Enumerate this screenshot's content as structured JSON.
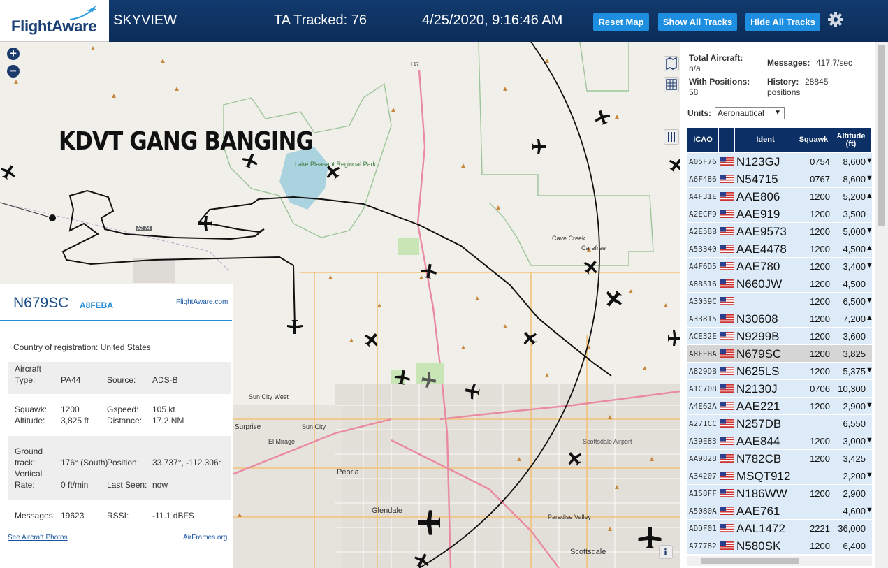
{
  "header": {
    "logo_text": "FlightAware",
    "site_name": "SKYVIEW",
    "tracked": "TA Tracked: 76",
    "clock": "4/25/2020, 9:16:46 AM",
    "reset_label": "Reset Map",
    "show_label": "Show All Tracks",
    "hide_label": "Hide All Tracks"
  },
  "map": {
    "graffiti": "KDVT GANG BANGING",
    "labels": {
      "lake_pleasant": "Lake Pleasant Regional Park",
      "cave_creek": "Cave Creek",
      "carefree": "Carefree",
      "sun_city_west": "Sun City West",
      "sun_city": "Sun City",
      "surprise": "Surprise",
      "el_mirage": "El Mirage",
      "peoria": "Peoria",
      "glendale": "Glendale",
      "paradise_valley": "Paradise Valley",
      "scottsdale": "Scottsdale",
      "scottsdale_airport": "Scottsdale Airport",
      "az74": "AZ 74",
      "i17": "I 17"
    }
  },
  "info": {
    "callsign": "N679SC",
    "icao": "A8FEBA",
    "fa_link": "FlightAware.com",
    "country_label": "Country of registration:",
    "country": "United States",
    "aircraft_type_label": "Aircraft Type:",
    "aircraft_type": "PA44",
    "source_label": "Source:",
    "source": "ADS-B",
    "squawk_label": "Squawk:",
    "squawk": "1200",
    "altitude_label": "Altitude:",
    "altitude": "3,825 ft",
    "gspeed_label": "Gspeed:",
    "gspeed": "105 kt",
    "distance_label": "Distance:",
    "distance": "17.2 NM",
    "track_label": "Ground track:",
    "track": "176° (South)",
    "position_label": "Position:",
    "position": "33.737°, -112.306°",
    "vrate_label": "Vertical Rate:",
    "vrate": "0 ft/min",
    "lastseen_label": "Last Seen:",
    "lastseen": "now",
    "messages_label": "Messages:",
    "messages": "19623",
    "rssi_label": "RSSI:",
    "rssi": "-11.1 dBFS",
    "photos_link": "See Aircraft Photos",
    "airframes_link": "AirFrames.org"
  },
  "stats": {
    "total_label": "Total Aircraft:",
    "total": "n/a",
    "positions_label": "With Positions:",
    "positions": "58",
    "messages_label": "Messages:",
    "messages": "417.7/sec",
    "history_label": "History:",
    "history": "28845 positions"
  },
  "units": {
    "label": "Units:",
    "selected": "Aeronautical"
  },
  "table": {
    "headers": [
      "ICAO",
      "Ident",
      "Squawk",
      "Altitude (ft)"
    ],
    "rows": [
      {
        "icao": "A05F76",
        "ident": "N123GJ",
        "squawk": "0754",
        "alt": "8,600",
        "trend": "▼"
      },
      {
        "icao": "A6F486",
        "ident": "N54715",
        "squawk": "0767",
        "alt": "8,600",
        "trend": "▼"
      },
      {
        "icao": "A4F31E",
        "ident": "AAE806",
        "squawk": "1200",
        "alt": "5,200",
        "trend": "▲"
      },
      {
        "icao": "A2ECF9",
        "ident": "AAE919",
        "squawk": "1200",
        "alt": "3,500",
        "trend": ""
      },
      {
        "icao": "A2E58B",
        "ident": "AAE9573",
        "squawk": "1200",
        "alt": "5,000",
        "trend": "▼"
      },
      {
        "icao": "A53340",
        "ident": "AAE4478",
        "squawk": "1200",
        "alt": "4,500",
        "trend": "▲"
      },
      {
        "icao": "A4F6D5",
        "ident": "AAE780",
        "squawk": "1200",
        "alt": "3,400",
        "trend": "▼"
      },
      {
        "icao": "A8B516",
        "ident": "N660JW",
        "squawk": "1200",
        "alt": "4,500",
        "trend": ""
      },
      {
        "icao": "A3059C",
        "ident": "",
        "squawk": "1200",
        "alt": "6,500",
        "trend": "▼"
      },
      {
        "icao": "A33815",
        "ident": "N30608",
        "squawk": "1200",
        "alt": "7,200",
        "trend": "▲"
      },
      {
        "icao": "ACE32E",
        "ident": "N9299B",
        "squawk": "1200",
        "alt": "3,600",
        "trend": ""
      },
      {
        "icao": "A8FEBA",
        "ident": "N679SC",
        "squawk": "1200",
        "alt": "3,825",
        "trend": ""
      },
      {
        "icao": "A829DB",
        "ident": "N625LS",
        "squawk": "1200",
        "alt": "5,375",
        "trend": "▼"
      },
      {
        "icao": "A1C708",
        "ident": "N2130J",
        "squawk": "0706",
        "alt": "10,300",
        "trend": ""
      },
      {
        "icao": "A4E62A",
        "ident": "AAE221",
        "squawk": "1200",
        "alt": "2,900",
        "trend": "▼"
      },
      {
        "icao": "A271CC",
        "ident": "N257DB",
        "squawk": "",
        "alt": "6,550",
        "trend": ""
      },
      {
        "icao": "A39E83",
        "ident": "AAE844",
        "squawk": "1200",
        "alt": "3,000",
        "trend": "▼"
      },
      {
        "icao": "AA9828",
        "ident": "N782CB",
        "squawk": "1200",
        "alt": "3,425",
        "trend": ""
      },
      {
        "icao": "A34207",
        "ident": "MSQT912",
        "squawk": "",
        "alt": "2,200",
        "trend": "▼"
      },
      {
        "icao": "A158FF",
        "ident": "N186WW",
        "squawk": "1200",
        "alt": "2,900",
        "trend": ""
      },
      {
        "icao": "A5080A",
        "ident": "AAE761",
        "squawk": "",
        "alt": "4,600",
        "trend": "▼"
      },
      {
        "icao": "ADDF01",
        "ident": "AAL1472",
        "squawk": "2221",
        "alt": "36,000",
        "trend": ""
      },
      {
        "icao": "A77782",
        "ident": "N580SK",
        "squawk": "1200",
        "alt": "6,400",
        "trend": ""
      }
    ]
  },
  "colors": {
    "header_bg": "#0c2d58",
    "button_bg": "#1e8fe0",
    "table_header": "#0c3066",
    "row_bg": "#dcebf7",
    "row_selected": "#d5d5d5",
    "link": "#1a56a0"
  }
}
